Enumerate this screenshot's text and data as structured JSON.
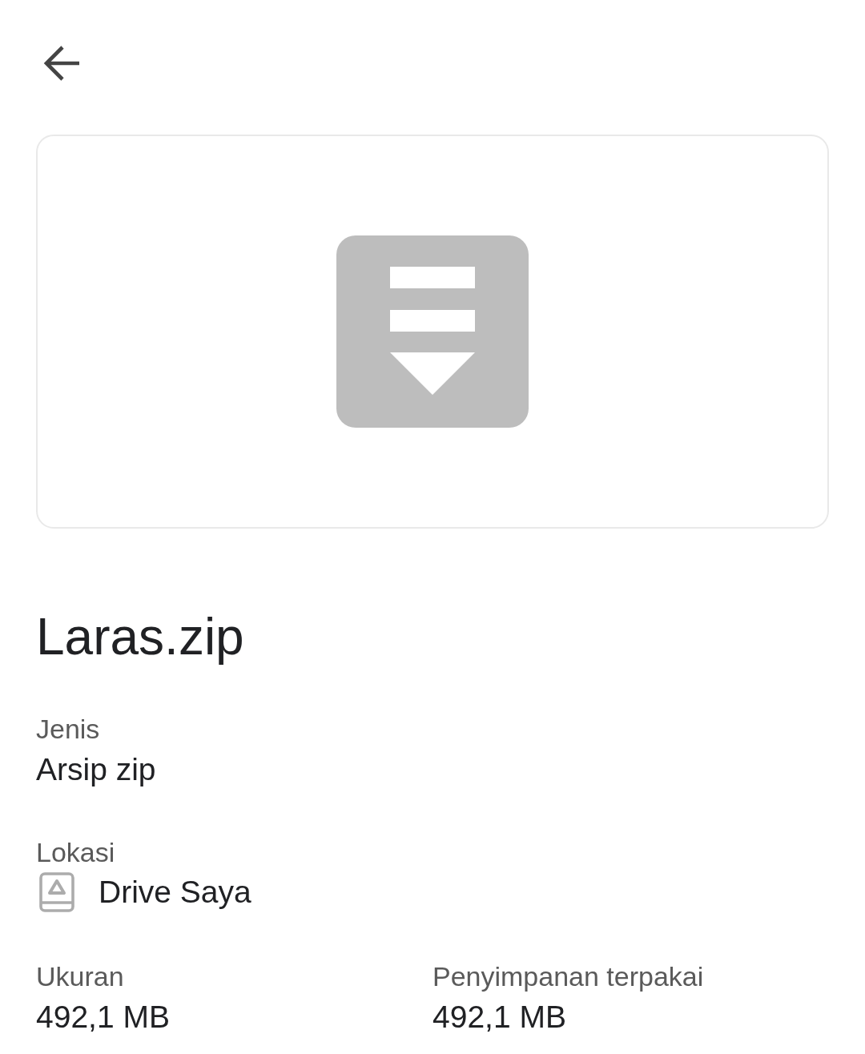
{
  "file": {
    "name": "Laras.zip"
  },
  "details": [
    {
      "kind": "text",
      "label": "Jenis",
      "value": "Arsip zip"
    },
    {
      "kind": "location",
      "label": "Lokasi",
      "value": "Drive Saya"
    }
  ],
  "stats": [
    {
      "label": "Ukuran",
      "value": "492,1 MB"
    },
    {
      "label": "Penyimpanan terpakai",
      "value": "492,1 MB"
    }
  ]
}
